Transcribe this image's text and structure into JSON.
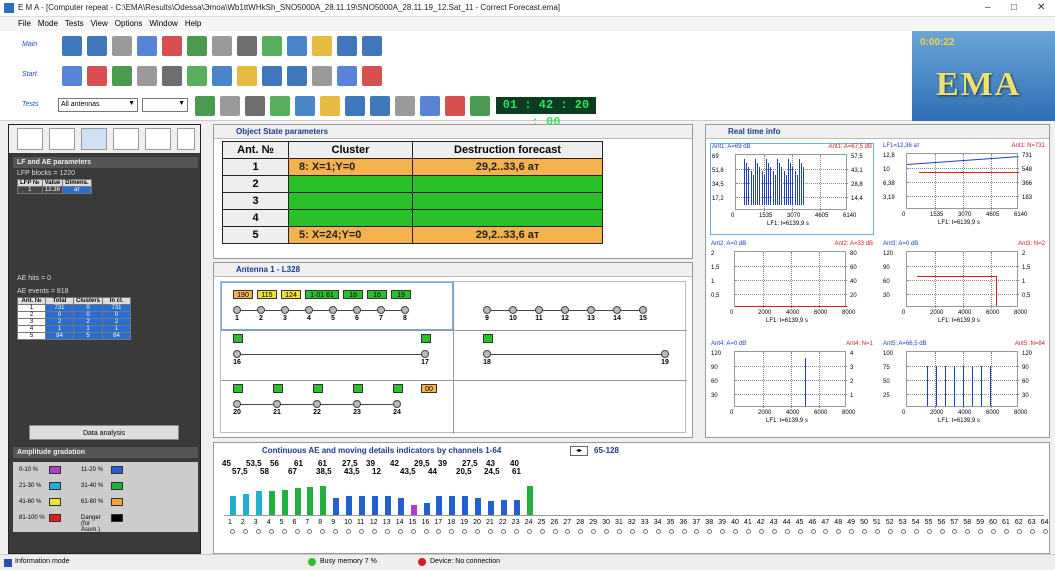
{
  "window": {
    "title": "E M A - [Computer repeat - C:\\EMA\\Results\\Odessa\\Эmoa\\Wb1ttWHkSh_SNO5000A_28.11.19\\SNO5000A_28.11.19_12.Sat_11 - Correct Forecast.ema]",
    "minimize": "–",
    "maximize": "□",
    "close": "✕"
  },
  "menu": [
    "File",
    "Mode",
    "Tests",
    "View",
    "Options",
    "Window",
    "Help"
  ],
  "toolbar": {
    "row_labels": [
      "Main",
      "Start",
      "Tests"
    ],
    "antenna_select": "All antennas",
    "clock": "01 : 42 : 20 : 00"
  },
  "logo": {
    "time": "0:00:22",
    "name": "EMA"
  },
  "left_panel": {
    "section1_title": "LF and AE parameters",
    "lfp_blocks": "LFP blocks = 1220",
    "lfp_cols": [
      "LFP №",
      "Value",
      "Dimens."
    ],
    "lfp_rows": [
      [
        "1",
        "12.36",
        "ат"
      ]
    ],
    "ae_hits": "AE hits = 0",
    "ae_events": "AE events = 818",
    "ae_cols": [
      "Ant. №",
      "Total",
      "Clusters",
      "In cl."
    ],
    "ae_rows": [
      [
        "1",
        "731",
        "0",
        "731"
      ],
      [
        "2",
        "0",
        "0",
        "0"
      ],
      [
        "3",
        "2",
        "2",
        "2"
      ],
      [
        "4",
        "1",
        "1",
        "1"
      ],
      [
        "5",
        "84",
        "5",
        "84"
      ]
    ],
    "data_analysis": "Data analysis",
    "amp_title": "Amplitude gradation",
    "amp_items": [
      {
        "label": "0-10 %",
        "color": "#b040c0"
      },
      {
        "label": "11-20 %",
        "color": "#2060d0"
      },
      {
        "label": "21-30 %",
        "color": "#20b0d0"
      },
      {
        "label": "31-40 %",
        "color": "#20b040"
      },
      {
        "label": "41-60 %",
        "color": "#f0e030"
      },
      {
        "label": "61-80 %",
        "color": "#f0a040"
      },
      {
        "label": "81-100 %",
        "color": "#e02020"
      },
      {
        "label": "Danger (for Asum.)",
        "color": "#000000"
      }
    ]
  },
  "osp": {
    "title": "Object State parameters",
    "cols": [
      "Ant. №",
      "Cluster",
      "Destruction forecast"
    ],
    "rows": [
      {
        "n": "1",
        "cluster": "8: X=1;Y=0",
        "forecast": "29,2..33,6 ат",
        "color": "ora"
      },
      {
        "n": "2",
        "cluster": "",
        "forecast": "",
        "color": "grn"
      },
      {
        "n": "3",
        "cluster": "",
        "forecast": "",
        "color": "grn"
      },
      {
        "n": "4",
        "cluster": "",
        "forecast": "",
        "color": "grn"
      },
      {
        "n": "5",
        "cluster": "5: X=24;Y=0",
        "forecast": "29,2..33,6 ат",
        "color": "ora"
      }
    ]
  },
  "antenna": {
    "title": "Antenna 1 - L328",
    "row1_boxes": [
      "190",
      "115",
      "124",
      "1·01 61",
      "18",
      "16",
      "19"
    ],
    "row1_left": [
      "1",
      "2",
      "3",
      "4",
      "5",
      "6",
      "7",
      "8"
    ],
    "row1_right": [
      "9",
      "10",
      "11",
      "12",
      "13",
      "14",
      "15"
    ],
    "row2_left": [
      "16",
      "17"
    ],
    "row2_right": [
      "18",
      "19"
    ],
    "row3_left": [
      "20",
      "21",
      "22",
      "23",
      "24"
    ],
    "row3_box": "00"
  },
  "rti": {
    "title": "Real time info",
    "plot1": {
      "tl": "Ant1: A=69 dB",
      "tr": "Ant1: A=67,5 dB",
      "y": [
        "69",
        "51,8",
        "34,5",
        "17,2"
      ],
      "yr": [
        "57,5",
        "43,1",
        "28,8",
        "14,4"
      ],
      "x": [
        "0",
        "1535",
        "3070",
        "4605",
        "6140"
      ],
      "xl": "LF1: t=6139,9 s"
    },
    "plot2": {
      "tl": "LF1=12,36 ат",
      "tr": "Ant1: N=731",
      "y": [
        "12,8",
        "10",
        "6,38",
        "3,19"
      ],
      "yr": [
        "731",
        "548",
        "366",
        "183"
      ],
      "x": [
        "0",
        "1535",
        "3070",
        "4605",
        "6140"
      ],
      "xl": "LF1: t=6139,9 s"
    },
    "plot3": {
      "tl": "Ant2: A=0 dB",
      "tr": "Ant2: A=33 dB",
      "y": [
        "2",
        "1,5",
        "1",
        "0,5"
      ],
      "yr": [
        "80",
        "60",
        "40",
        "20"
      ],
      "x": [
        "0",
        "2000",
        "4000",
        "6000",
        "8000"
      ],
      "xl": "LF1: t=6139,9 s"
    },
    "plot4": {
      "tl": "Ant3: A=0 dB",
      "tr": "Ant3: N=2",
      "y": [
        "120",
        "90",
        "60",
        "30"
      ],
      "yr": [
        "2",
        "1,5",
        "1",
        "0,5"
      ],
      "x": [
        "0",
        "2000",
        "4000",
        "6000",
        "8000"
      ],
      "xl": "LF1: t=6139,9 s"
    },
    "plot5": {
      "tl": "Ant4: A=0 dB",
      "tr": "Ant4: N=1",
      "y": [
        "120",
        "90",
        "60",
        "30"
      ],
      "yr": [
        "4",
        "3",
        "2",
        "1"
      ],
      "x": [
        "0",
        "2000",
        "4000",
        "6000",
        "8000"
      ],
      "xl": "LF1: t=6139,9 s"
    },
    "plot6": {
      "tl": "Ant5: A=66,5 dB",
      "tr": "Ant5: N=84",
      "y": [
        "100",
        "75",
        "50",
        "25"
      ],
      "yr": [
        "120",
        "90",
        "60",
        "30"
      ],
      "x": [
        "0",
        "2000",
        "4000",
        "6000",
        "8000"
      ],
      "xl": "LF1: t=6139,9 s"
    }
  },
  "continuous": {
    "title": "Continuous AE and moving details indicators  by channels 1-64",
    "range2": "65-128",
    "top_values": [
      "45",
      "53,5",
      "56",
      "61",
      "61",
      "27,5",
      "39",
      "42",
      "29,5",
      "39",
      "27,5",
      "43",
      "40"
    ],
    "bottom_values": [
      "57,5",
      "58",
      "67",
      "38,5",
      "43,5",
      "12",
      "43,5",
      "44",
      "20,5",
      "24,5",
      "61"
    ],
    "channels_count": 64,
    "bar_heights": [
      0.55,
      0.62,
      0.7,
      0.72,
      0.75,
      0.78,
      0.82,
      0.85,
      0.5,
      0.55,
      0.55,
      0.55,
      0.55,
      0.5,
      0.3,
      0.35,
      0.55,
      0.55,
      0.55,
      0.5,
      0.4,
      0.45,
      0.45,
      0.85
    ],
    "bar_colors": [
      "#20b0d0",
      "#20b0d0",
      "#20b0d0",
      "#20b040",
      "#20b040",
      "#20b040",
      "#20b040",
      "#20b040",
      "#2060d0",
      "#2060d0",
      "#2060d0",
      "#2060d0",
      "#2060d0",
      "#2060d0",
      "#b040c0",
      "#2060d0",
      "#2060d0",
      "#2060d0",
      "#2060d0",
      "#2060d0",
      "#2060d0",
      "#2060d0",
      "#2060d0",
      "#20b040"
    ]
  },
  "status": {
    "mode": "Information mode",
    "memory": "Busy memory 7 %",
    "device": "Device: No connection"
  }
}
